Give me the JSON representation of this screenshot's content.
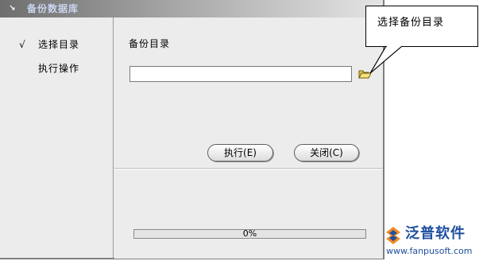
{
  "window": {
    "title": "备份数据库"
  },
  "steps": [
    {
      "check": "√",
      "label": "选择目录"
    },
    {
      "check": "",
      "label": "执行操作"
    }
  ],
  "main": {
    "section_label": "备份目录",
    "directory_value": "",
    "execute_label": "执行(E)",
    "close_label": "关闭(C)"
  },
  "progress": {
    "value": 0,
    "label": "0%"
  },
  "callout": {
    "text": "选择备份目录"
  },
  "watermark": {
    "brand": "泛普软件",
    "url": "www.fanpusoft.com"
  },
  "colors": {
    "accent": "#1f4fa0",
    "title_text": "#c9d5f0",
    "panel": "#ececec"
  },
  "icons": {
    "folder": "folder-open-icon",
    "window": "window-icon"
  }
}
